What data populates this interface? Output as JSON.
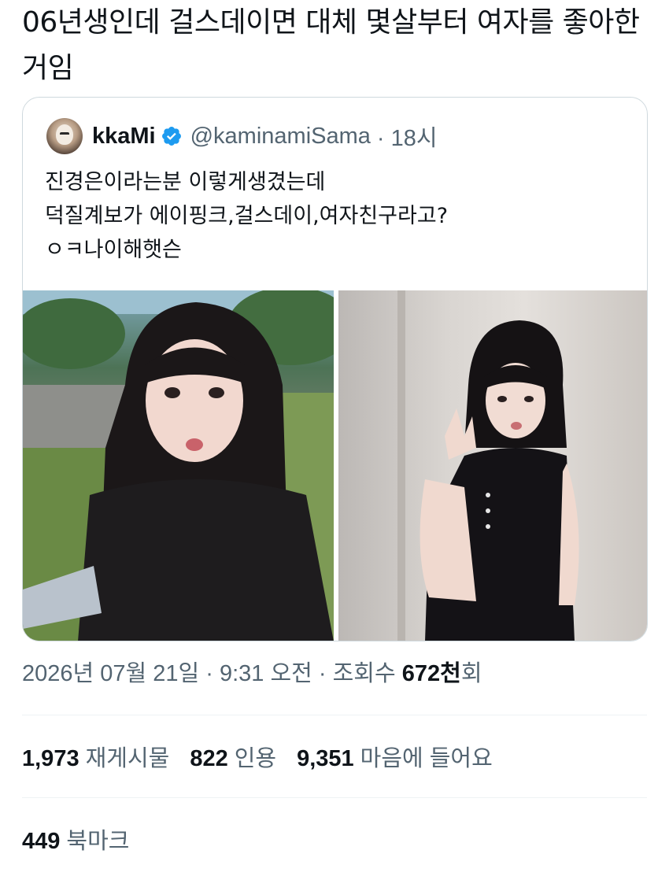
{
  "post": {
    "text": "06년생인데 걸스데이면 대체 몇살부터 여자를 좋아한거임"
  },
  "quoted": {
    "display_name": "kkaMi",
    "handle": "@kaminamiSama",
    "time": "· 18시",
    "lines": [
      "진경은이라는분   이렇게생겼는데",
      "덕질계보가  에이핑크,걸스데이,여자친구라고?",
      "ㅇㅋ나이해햇슨"
    ],
    "verified_color": "#1d9bf0",
    "avatar_icon": "cat-avatar-icon"
  },
  "meta": {
    "date": "2026년 07월 21일",
    "sep1": " · ",
    "time": "9:31 오전",
    "sep2": " · ",
    "views_label": "조회수 ",
    "views_value": "672천",
    "views_suffix": "회"
  },
  "stats": {
    "retweets_value": "1,973",
    "retweets_label": "재게시물",
    "quotes_value": "822",
    "quotes_label": "인용",
    "likes_value": "9,351",
    "likes_label": "마음에 들어요",
    "bookmarks_value": "449",
    "bookmarks_label": "북마크"
  }
}
